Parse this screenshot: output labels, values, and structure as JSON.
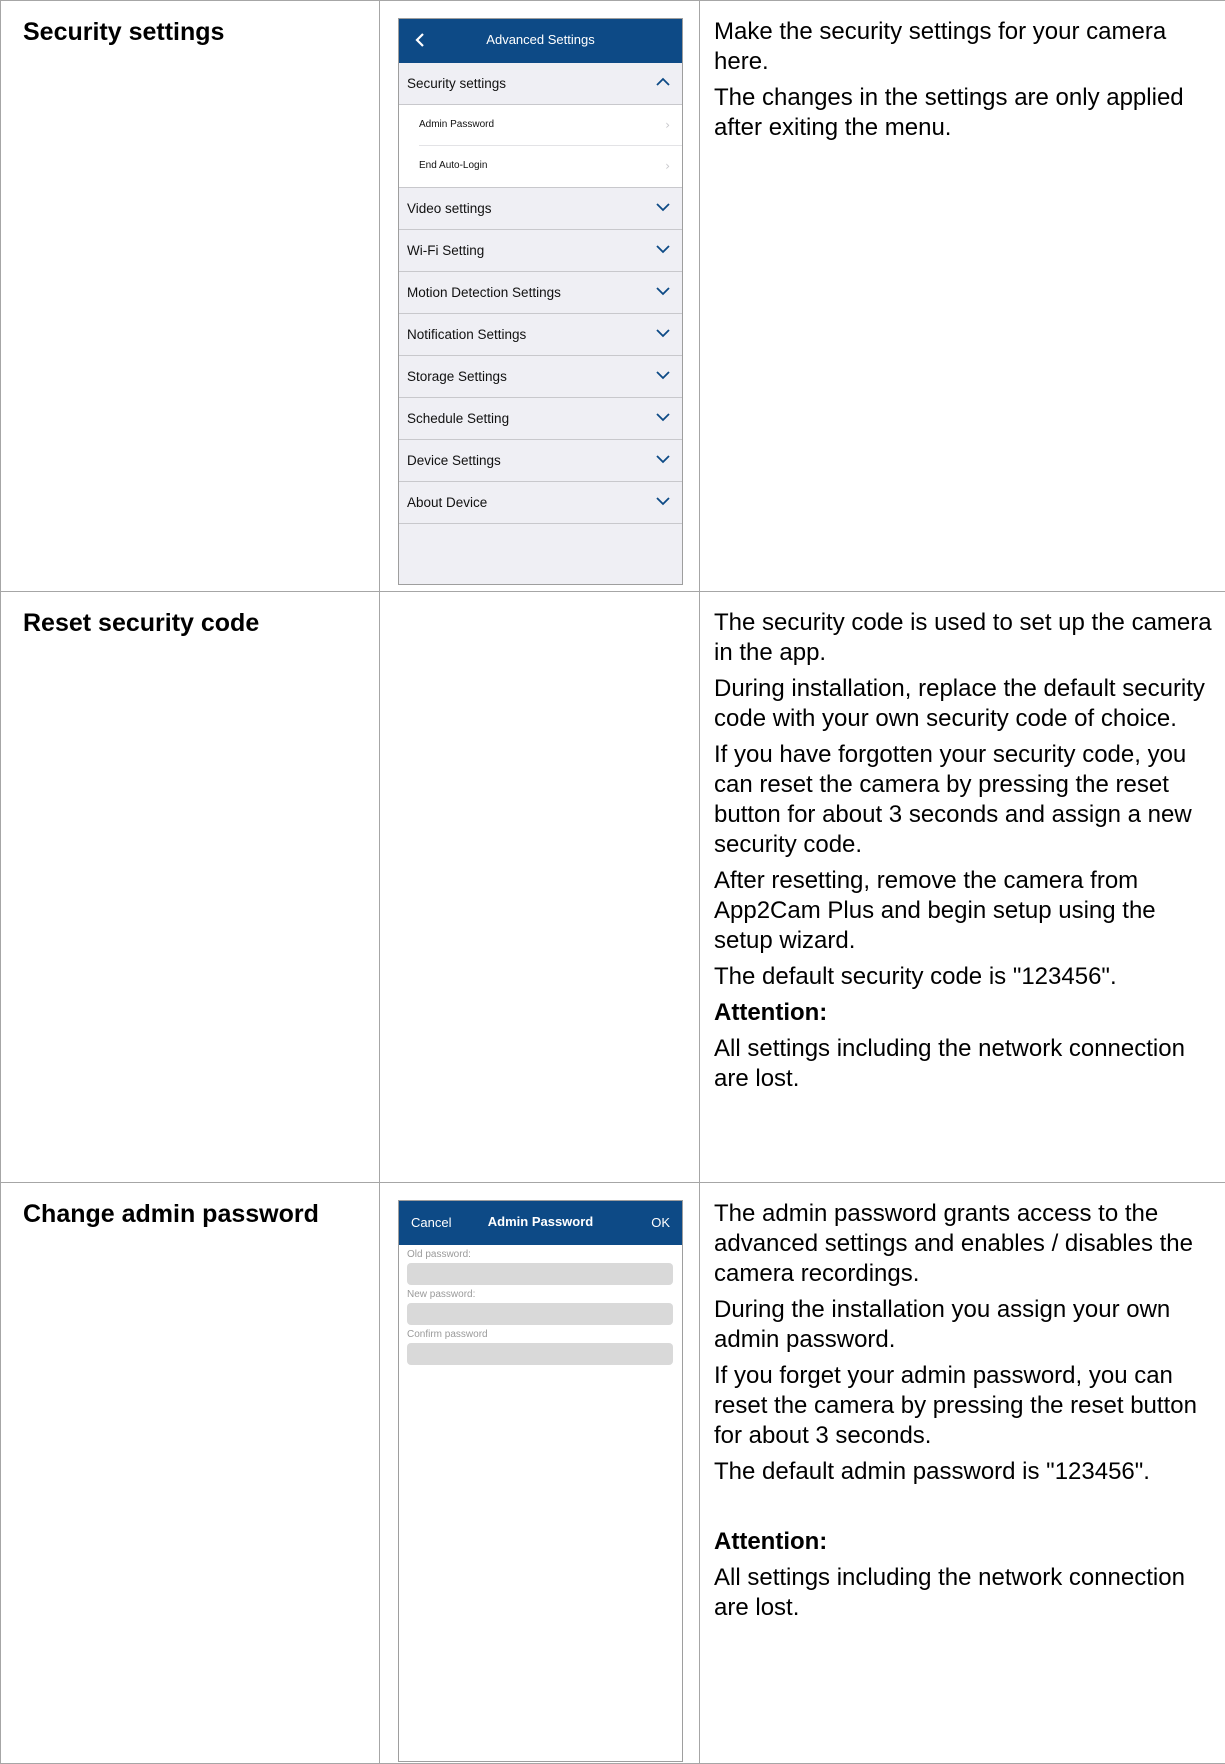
{
  "rows": [
    {
      "heading": "Security settings",
      "desc": [
        "Make the security settings for your camera here.",
        "The changes in the settings are only applied after exiting the menu."
      ]
    },
    {
      "heading": "Reset security code",
      "desc": [
        "The security code is used to set up the camera in the app.",
        "During installation, replace the default security code with your own security code of choice.",
        "If you have forgotten your security code, you can reset the camera by pressing the reset button for about 3 seconds and assign a new security code.",
        "After resetting, remove the camera from App2Cam Plus and begin setup using the setup wizard.",
        "The default security code is \"123456\".",
        "Attention:",
        "All settings including the network connection are lost."
      ]
    },
    {
      "heading": "Change admin password",
      "desc": [
        "The admin password grants access to the advanced settings and enables / disables the camera recordings.",
        "During the installation you assign your own admin password.",
        "If you forget your admin password, you can reset the camera by pressing the reset button for about 3 seconds.",
        "The default admin password is \"123456\".",
        "Attention:",
        "All settings including the network connection are lost."
      ]
    }
  ],
  "phone1": {
    "title": "Advanced Settings",
    "back_icon": "chevron-left-icon",
    "expanded_section": "Security settings",
    "sub_items": [
      "Admin Password",
      "End Auto-Login"
    ],
    "sections": [
      "Video settings",
      "Wi-Fi Setting",
      "Motion Detection Settings",
      "Notification Settings",
      "Storage Settings",
      "Schedule Setting",
      "Device Settings",
      "About Device"
    ],
    "accent_color": "#0d4a86"
  },
  "phone2": {
    "title": "Admin Password",
    "cancel": "Cancel",
    "ok": "OK",
    "fields": [
      "Old password:",
      "New password:",
      "Confirm password"
    ]
  }
}
